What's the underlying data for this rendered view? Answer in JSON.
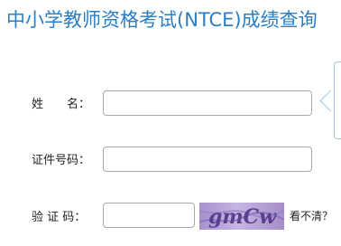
{
  "page": {
    "title": "中小学教师资格考试(NTCE)成绩查询"
  },
  "form": {
    "name_label": "姓　　名：",
    "name_value": "",
    "id_label": "证件号码：",
    "id_value": "",
    "captcha_label": "验 证 码：",
    "captcha_value": "",
    "captcha_text": "gmCw",
    "refresh_link": "看不清？"
  },
  "colors": {
    "title": "#2a7fc4",
    "input_border": "#a9a9a9",
    "captcha_bg": "#b49ed6",
    "captcha_text": "#5b3e8e",
    "callout_border": "#9ec6e6"
  }
}
